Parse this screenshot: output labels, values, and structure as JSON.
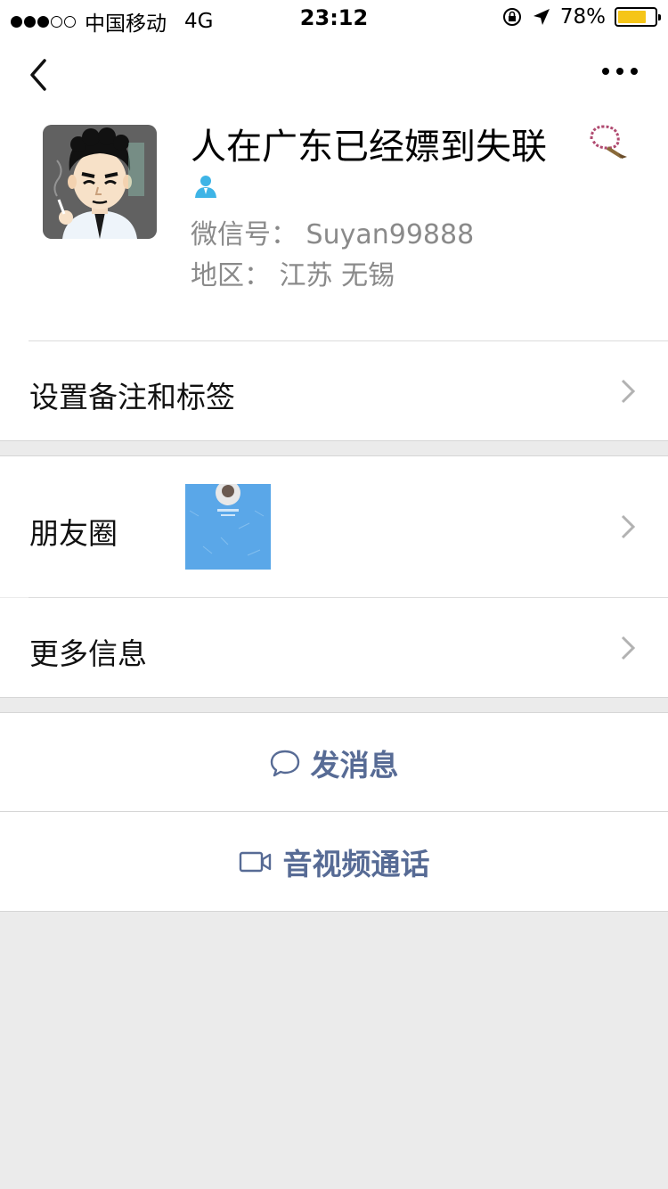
{
  "status_bar": {
    "carrier": "中国移动",
    "network": "4G",
    "time": "23:12",
    "battery": "78%",
    "battery_level": 0.78
  },
  "profile": {
    "name": "人在广东已经嫖到失联",
    "wechat_id_label": "微信号：",
    "wechat_id": "Suyan99888",
    "region_label": "地区：",
    "region": "江苏 无锡"
  },
  "rows": {
    "remark_tags": "设置备注和标签",
    "moments": "朋友圈",
    "more_info": "更多信息"
  },
  "actions": {
    "send_message": "发消息",
    "video_call": "音视频通话"
  },
  "colors": {
    "accent": "#576b95",
    "gender_icon": "#3eb4e6",
    "moments_thumb": "#5aa7e8",
    "battery": "#f5c518"
  }
}
